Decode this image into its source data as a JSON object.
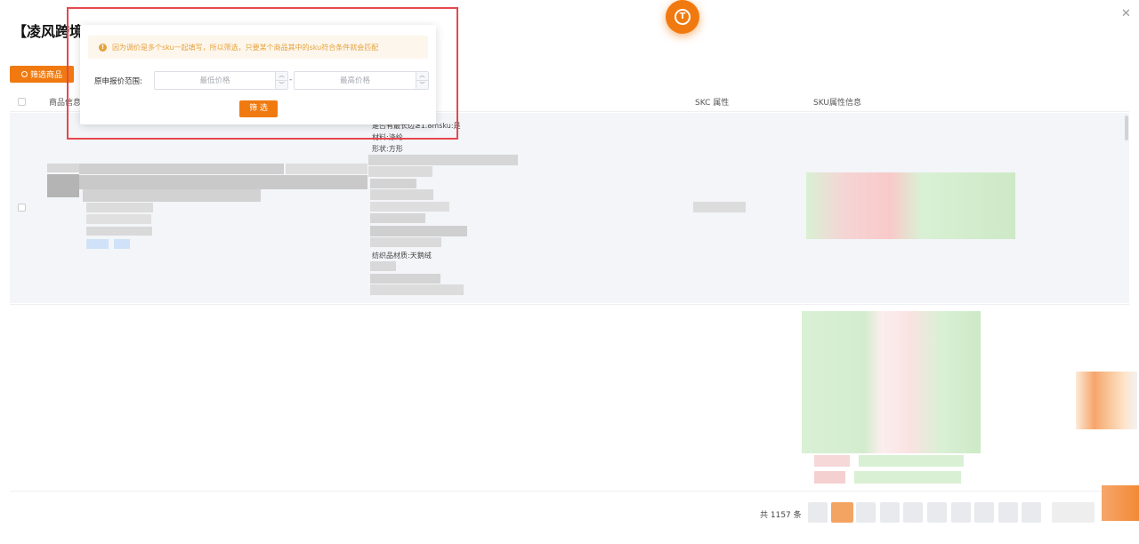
{
  "page": {
    "title": "【凌风跨境"
  },
  "toolbar": {
    "filter_label": "筛选商品"
  },
  "table": {
    "headers": {
      "product": "商品信息",
      "skc": "SKC 属性",
      "sku": "SKU属性信息"
    },
    "row1_attrs": [
      "是否有最长边≥1.8msku:是",
      "材料:涤纶",
      "形状:方形",
      "纺织品材质:天鹅绒"
    ]
  },
  "pagination": {
    "total": "共 1157 条",
    "current_page_color": "#f4a462"
  },
  "modal": {
    "warning": "因为调价是多个sku一起填写，所以筛选，只要某个商品其中的sku符合条件就会匹配",
    "range_label": "原申报价范围:",
    "min_placeholder": "最低价格",
    "max_placeholder": "最高价格",
    "separator": "-",
    "submit_label": "筛 选"
  },
  "icons": {
    "float": "t-logo-icon",
    "close": "close-icon",
    "search": "search-icon",
    "warning": "warning-icon",
    "stepper": [
      "chevron-up-icon",
      "chevron-down-icon"
    ]
  },
  "colors": {
    "accent": "#f07a10",
    "warning": "#e6a23c",
    "annotation": "#e5484d"
  }
}
